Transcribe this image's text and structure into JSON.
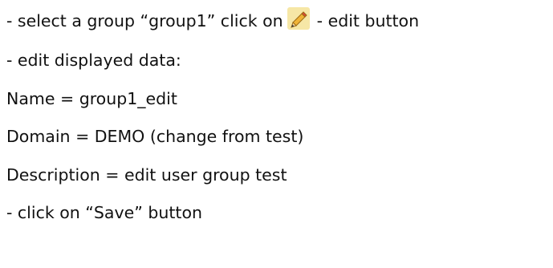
{
  "lines": [
    {
      "before_icon": "- select a group “group1” click on",
      "icon": "pencil-edit-icon",
      "after_icon": "- edit  button"
    },
    {
      "text": "- edit displayed data:"
    },
    {
      "text": "Name = group1_edit"
    },
    {
      "text": "Domain = DEMO  (change from test)"
    },
    {
      "text": "Description = edit user group test"
    },
    {
      "text": "- click on “Save” button"
    }
  ],
  "colors": {
    "text": "#111111",
    "icon_background": "#f6e7a6",
    "pencil_body": "#f0b437",
    "pencil_tip": "#d9473b"
  }
}
